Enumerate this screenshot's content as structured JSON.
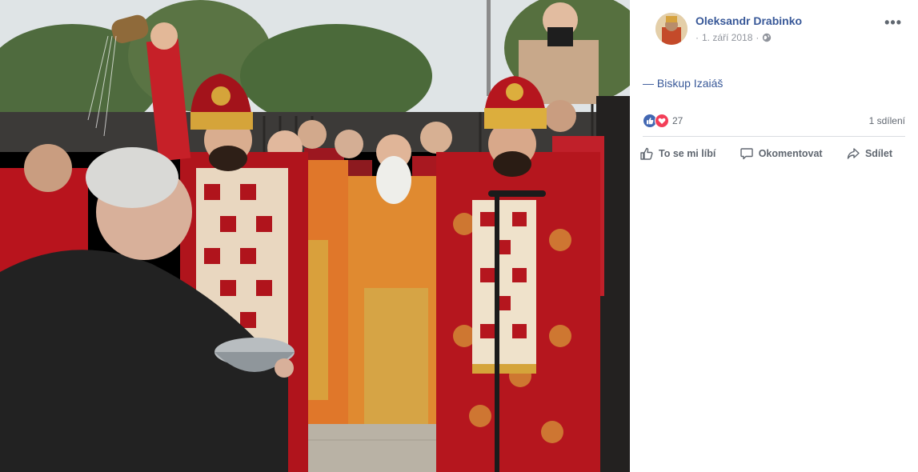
{
  "post": {
    "author": "Oleksandr Drabinko",
    "date": "1. září 2018",
    "privacy_icon": "globe-icon",
    "caption": "— Biskup Izaiáš"
  },
  "stats": {
    "reaction_count": "27",
    "reactions": [
      "like",
      "love"
    ],
    "shares": "1 sdílení"
  },
  "actions": {
    "like_label": "To se mi líbí",
    "comment_label": "Okomentovat",
    "share_label": "Sdílet"
  },
  "colors": {
    "link": "#385898",
    "muted": "#90949c",
    "like": "#4267b2",
    "love": "#f33e58",
    "vestment_red": "#b3141e",
    "vestment_gold": "#e0a03a"
  }
}
